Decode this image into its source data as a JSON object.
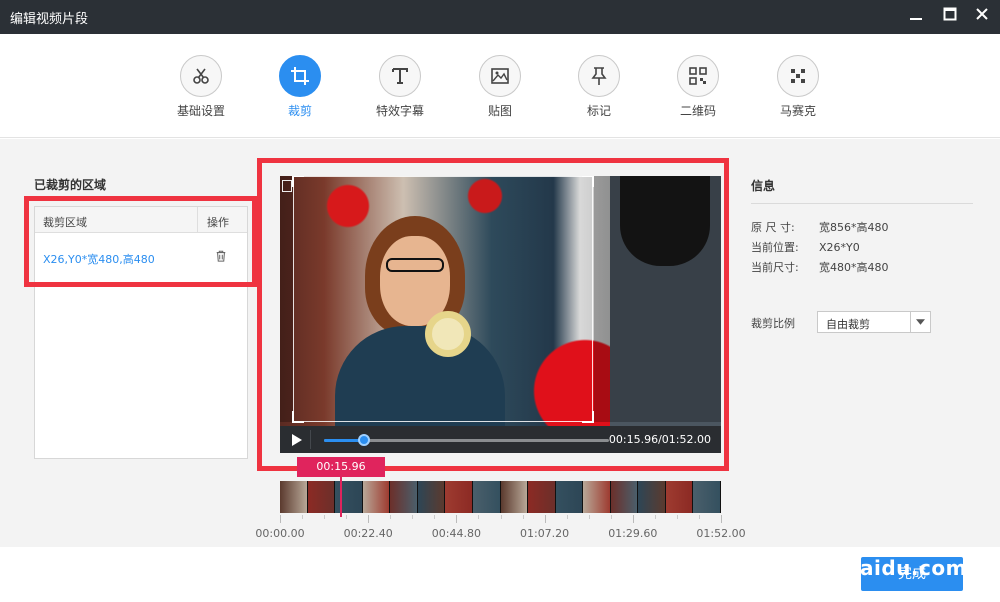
{
  "window": {
    "title": "编辑视频片段"
  },
  "toolbar": {
    "tools": [
      {
        "label": "基础设置",
        "icon": "scissors-icon"
      },
      {
        "label": "裁剪",
        "icon": "crop-icon",
        "active": true
      },
      {
        "label": "特效字幕",
        "icon": "text-icon"
      },
      {
        "label": "贴图",
        "icon": "image-icon"
      },
      {
        "label": "标记",
        "icon": "pin-icon"
      },
      {
        "label": "二维码",
        "icon": "qrcode-icon"
      },
      {
        "label": "马赛克",
        "icon": "mosaic-icon"
      }
    ]
  },
  "cropped": {
    "title": "已裁剪的区域",
    "headers": [
      "裁剪区域",
      "操作"
    ],
    "rows": [
      {
        "region": "X26,Y0*宽480,高480"
      }
    ]
  },
  "player": {
    "time": "00:15.96/01:52.00",
    "progress": 0.142
  },
  "timeline": {
    "current": "00:15.96",
    "ticks": [
      "00:00.00",
      "00:22.40",
      "00:44.80",
      "01:07.20",
      "01:29.60",
      "01:52.00"
    ]
  },
  "info": {
    "title": "信息",
    "rows": [
      {
        "label": "原 尺 寸:",
        "value": "宽856*高480"
      },
      {
        "label": "当前位置:",
        "value": "X26*Y0"
      },
      {
        "label": "当前尺寸:",
        "value": "宽480*高480"
      }
    ],
    "ratio_label": "裁剪比例",
    "ratio_value": "自由裁剪"
  },
  "footer": {
    "done_label": "完成",
    "watermark": "aidu.com"
  },
  "colors": {
    "accent": "#2b8ef0",
    "highlight": "#ef3340",
    "marker": "#e0245d",
    "titlebar": "#2b3036"
  }
}
